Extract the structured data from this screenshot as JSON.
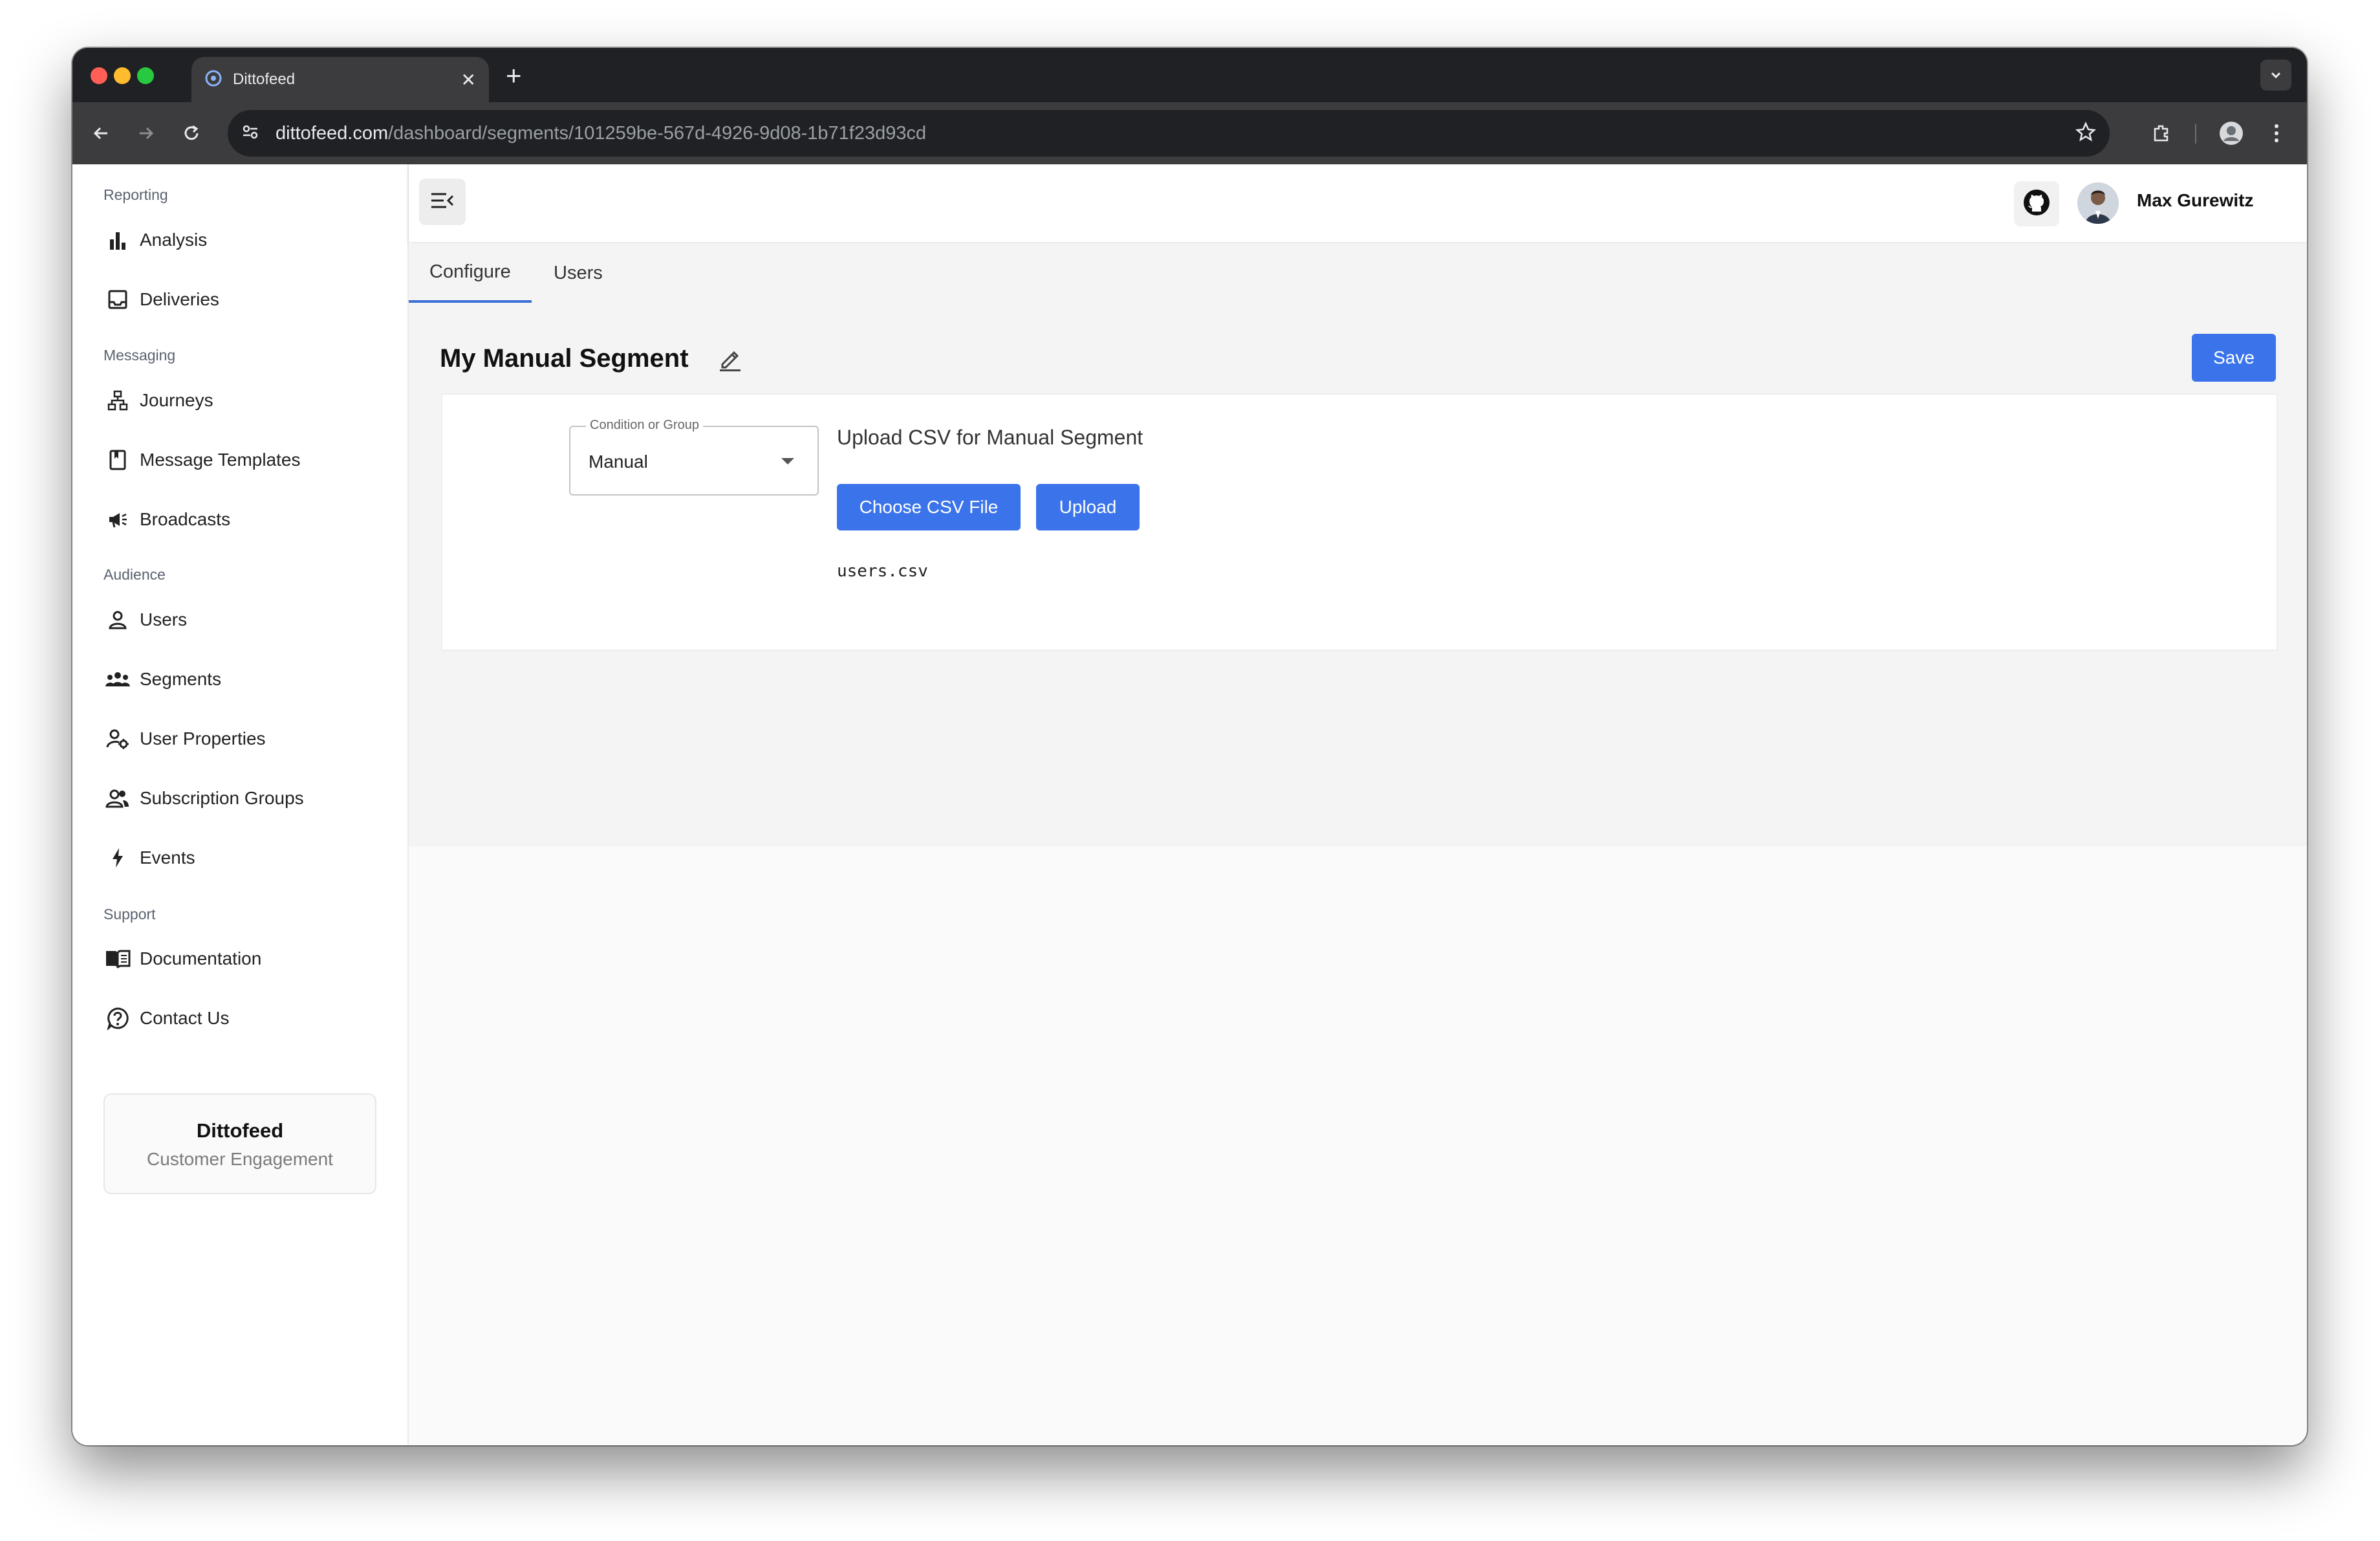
{
  "browser": {
    "tab_title": "Dittofeed",
    "url_host": "dittofeed.com",
    "url_path": "/dashboard/segments/101259be-567d-4926-9d08-1b71f23d93cd"
  },
  "sidebar": {
    "groups": [
      {
        "label": "Reporting",
        "items": [
          {
            "label": "Analysis",
            "icon": "bar-chart-icon"
          },
          {
            "label": "Deliveries",
            "icon": "inbox-icon"
          }
        ]
      },
      {
        "label": "Messaging",
        "items": [
          {
            "label": "Journeys",
            "icon": "sitemap-icon"
          },
          {
            "label": "Message Templates",
            "icon": "book-icon"
          },
          {
            "label": "Broadcasts",
            "icon": "megaphone-icon"
          }
        ]
      },
      {
        "label": "Audience",
        "items": [
          {
            "label": "Users",
            "icon": "user-icon"
          },
          {
            "label": "Segments",
            "icon": "group-icon"
          },
          {
            "label": "User Properties",
            "icon": "user-gear-icon"
          },
          {
            "label": "Subscription Groups",
            "icon": "users-icon"
          },
          {
            "label": "Events",
            "icon": "bolt-icon"
          }
        ]
      },
      {
        "label": "Support",
        "items": [
          {
            "label": "Documentation",
            "icon": "open-book-icon"
          },
          {
            "label": "Contact Us",
            "icon": "question-icon"
          }
        ]
      }
    ],
    "brand": {
      "name": "Dittofeed",
      "subtitle": "Customer Engagement"
    }
  },
  "header": {
    "user_name": "Max Gurewitz"
  },
  "tabs": [
    {
      "label": "Configure",
      "active": true
    },
    {
      "label": "Users",
      "active": false
    }
  ],
  "segment": {
    "title": "My Manual Segment",
    "save_label": "Save",
    "condition_legend": "Condition or Group",
    "condition_value": "Manual",
    "upload_title": "Upload CSV for Manual Segment",
    "choose_label": "Choose CSV File",
    "upload_label": "Upload",
    "file_name": "users.csv"
  },
  "colors": {
    "primary": "#3b74ea",
    "tab_indicator": "#3b6fd6"
  }
}
